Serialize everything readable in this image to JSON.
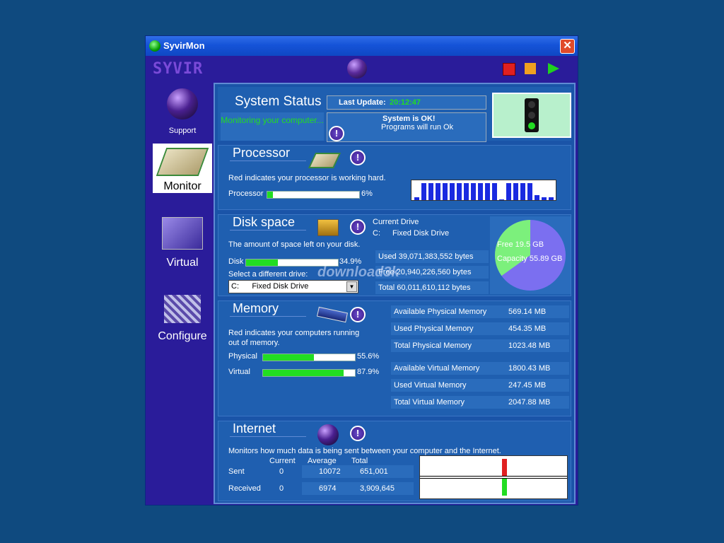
{
  "window": {
    "title": "SyvirMon",
    "close_label": "✕"
  },
  "topbar": {
    "brand": "SYVIR"
  },
  "sidebar": {
    "items": [
      {
        "label": "Support"
      },
      {
        "label": "Monitor"
      },
      {
        "label": "Virtual"
      },
      {
        "label": "Configure"
      }
    ]
  },
  "status": {
    "title": "System Status",
    "monitoring": "Monitoring your computer...",
    "last_update_label": "Last Update:",
    "last_update_value": "20:12:47",
    "ok_title": "System is OK!",
    "ok_sub": "Programs will run Ok",
    "info_label": "!"
  },
  "processor": {
    "title": "Processor",
    "desc": "Red indicates your processor is working hard.",
    "label": "Processor",
    "percent_text": "6%",
    "percent": 6,
    "history": [
      0.15,
      1,
      1,
      1,
      1,
      1,
      1,
      1,
      1,
      1,
      1,
      1,
      0.05,
      1,
      1,
      1,
      1,
      0.3,
      0.15,
      0.15
    ]
  },
  "disk": {
    "title": "Disk space",
    "desc": "The amount of space left on your disk.",
    "label": "Disk",
    "percent_text": "34.9%",
    "percent": 34.9,
    "select_label": "Select a different drive:",
    "select_value": "C:      Fixed Disk Drive",
    "current_drive_label": "Current Drive",
    "current_drive_letter": "C:",
    "current_drive_type": "Fixed Disk Drive",
    "used": "Used 39,071,383,552 bytes",
    "free": "Free 20,940,226,560 bytes",
    "total": "Total  60,011,610,112 bytes",
    "pie_free": "Free 19.5 GB",
    "pie_capacity": "Capacity 55.89 GB",
    "pie_free_fraction": 0.349,
    "watermark": "download3k"
  },
  "memory": {
    "title": "Memory",
    "desc": "Red indicates your computers running out of memory.",
    "physical_label": "Physical",
    "physical_text": "55.6%",
    "physical_percent": 55.6,
    "virtual_label": "Virtual",
    "virtual_text": "87.9%",
    "virtual_percent": 87.9,
    "stats": [
      {
        "label": "Available Physical Memory",
        "value": "569.14 MB"
      },
      {
        "label": "Used Physical Memory",
        "value": "454.35 MB"
      },
      {
        "label": "Total Physical Memory",
        "value": "1023.48 MB"
      },
      {
        "label": "Available Virtual Memory",
        "value": "1800.43 MB"
      },
      {
        "label": "Used Virtual Memory",
        "value": "247.45 MB"
      },
      {
        "label": "Total Virtual Memory",
        "value": "2047.88 MB"
      }
    ]
  },
  "internet": {
    "title": "Internet",
    "desc": "Monitors how much data is being sent between your computer and the Internet.",
    "col_current": "Current",
    "col_average": "Average",
    "col_total": "Total",
    "sent_label": "Sent",
    "sent_current": "0",
    "sent_average": "10072",
    "sent_total": "651,001",
    "recv_label": "Received",
    "recv_current": "0",
    "recv_average": "6974",
    "recv_total": "3,909,645"
  },
  "colors": {
    "ok_green": "#22dd22",
    "alert_red": "#e02020",
    "cpu_blue": "#1a2ae0",
    "pie_used": "#7b6ff0",
    "pie_free": "#7cf07c"
  }
}
